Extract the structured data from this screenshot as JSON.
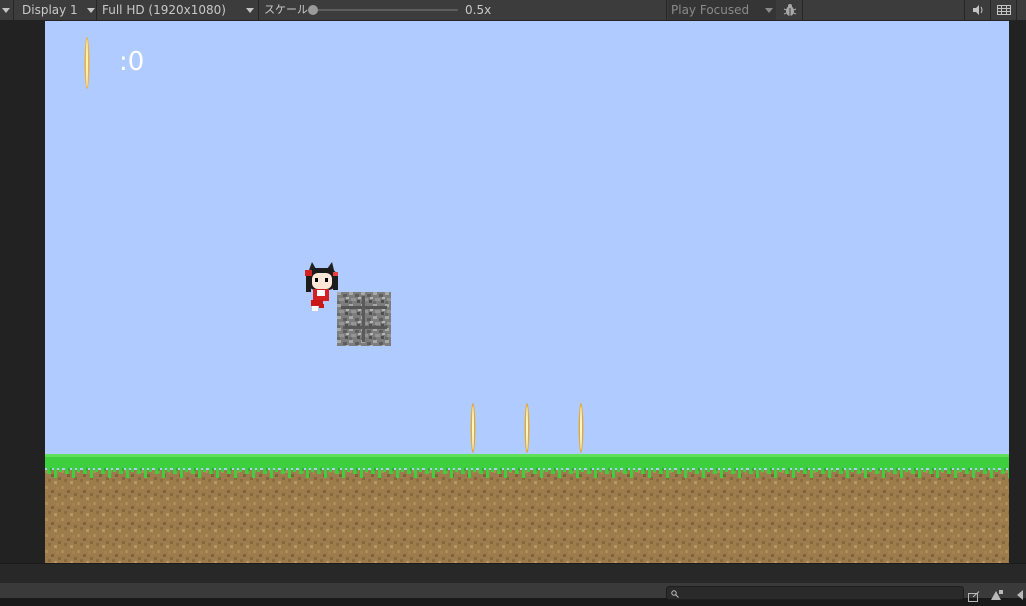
{
  "toolbar": {
    "display": "Display 1",
    "resolution": "Full HD (1920x1080)",
    "scale_label": "スケール",
    "scale_value": "0.5x",
    "scale_level": 0.0,
    "play_mode": "Play Focused",
    "icons": [
      "bug-icon",
      "audio-icon",
      "stats-icon"
    ]
  },
  "game": {
    "score": ":0",
    "coins_visible": 3
  },
  "colors": {
    "sky": "#b0cbff",
    "grass": "#3ecf3e",
    "dirt": "#9c7b4c",
    "toolbar_bg": "#3c3c3c"
  },
  "bottom": {
    "search_placeholder": ""
  }
}
